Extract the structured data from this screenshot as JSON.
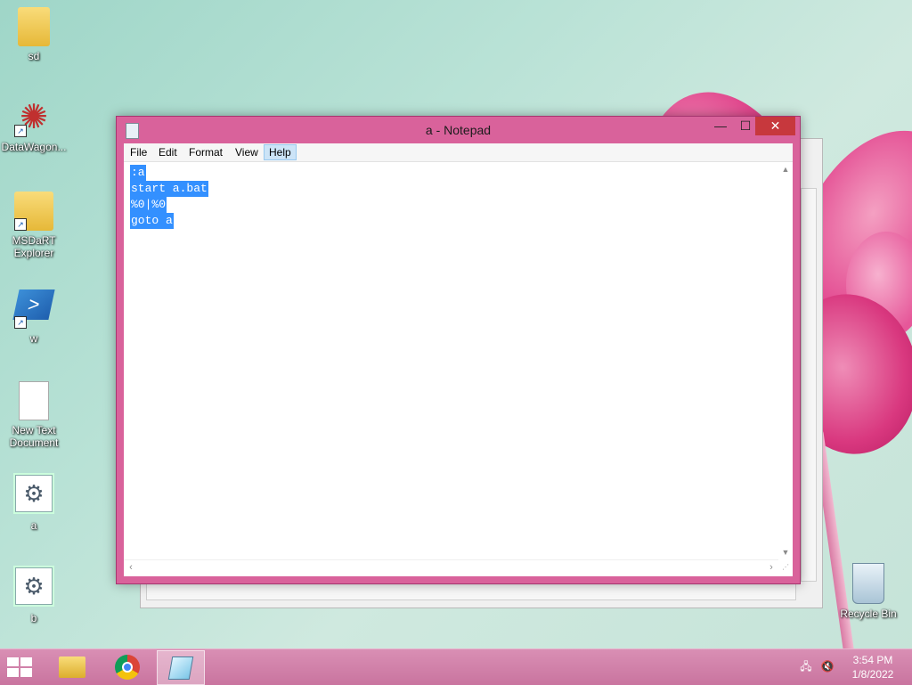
{
  "desktop": {
    "icons": [
      {
        "label": "sd",
        "icon": "folder-icon"
      },
      {
        "label": "DataWagon...",
        "icon": "star-shortcut-icon"
      },
      {
        "label": "MSDaRT Explorer",
        "icon": "folder-shortcut-icon"
      },
      {
        "label": "w",
        "icon": "powershell-shortcut-icon"
      },
      {
        "label": "New Text Document",
        "icon": "text-document-icon"
      },
      {
        "label": "a",
        "icon": "batch-file-icon"
      },
      {
        "label": "b",
        "icon": "batch-file-icon"
      },
      {
        "label": "Recycle Bin",
        "icon": "recycle-bin-icon"
      }
    ]
  },
  "window": {
    "title": "a - Notepad",
    "controls": {
      "minimize": "—",
      "maximize": "☐",
      "close": "✕"
    },
    "menu": [
      "File",
      "Edit",
      "Format",
      "View",
      "Help"
    ],
    "active_menu": "Help",
    "text_lines": [
      ":a",
      "start a.bat",
      "%0|%0",
      "goto a"
    ],
    "selection_color": "#3390ff",
    "frame_color": "#d9629b"
  },
  "taskbar": {
    "pinned": [
      "file-explorer-icon",
      "chrome-icon",
      "notepad-icon"
    ],
    "active_app": "notepad-icon",
    "clock_time": "3:54 PM",
    "clock_date": "1/8/2022"
  }
}
